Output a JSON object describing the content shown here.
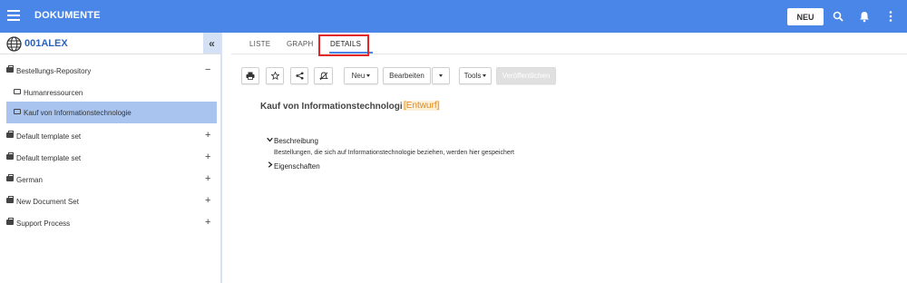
{
  "header": {
    "title": "DOKUMENTE",
    "new_button": "NEU",
    "bg_color": "#4a86e8"
  },
  "sidebar": {
    "workspace_title": "001ALEX",
    "collapse_label": "«",
    "items": [
      {
        "label": "Bestellungs-Repository",
        "type": "repository",
        "sign": "−"
      },
      {
        "label": "Humanressourcen",
        "type": "folder"
      },
      {
        "label": "Kauf von Informationstechnologie",
        "type": "folder",
        "selected": true
      },
      {
        "label": "Default template set",
        "type": "repository",
        "sign": "+"
      },
      {
        "label": "Default template set",
        "type": "repository",
        "sign": "+"
      },
      {
        "label": "German",
        "type": "repository",
        "sign": "+"
      },
      {
        "label": "New Document Set",
        "type": "repository",
        "sign": "+"
      },
      {
        "label": "Support Process",
        "type": "repository",
        "sign": "+"
      }
    ]
  },
  "tabs": [
    {
      "label": "LISTE"
    },
    {
      "label": "GRAPH"
    },
    {
      "label": "DETAILS",
      "active": true
    }
  ],
  "toolbar": {
    "print_icon": "printer-icon",
    "favorite_icon": "star-icon",
    "share_icon": "share-icon",
    "notify_off_icon": "bell-off-icon",
    "new_label": "Neu",
    "edit_label": "Bearbeiten",
    "tools_label": "Tools",
    "publish_label": "Veröffentlichen"
  },
  "document": {
    "title": "Kauf von Informationstechnologie",
    "status": "[Entwurf]",
    "description_heading": "Beschreibung",
    "description_text": "Bestellungen, die sich auf Informationstechnologie beziehen, werden hier gespeichert",
    "properties_heading": "Eigenschaften"
  },
  "colors": {
    "accent": "#4a86e8",
    "selected_row": "#a9c5ef",
    "draft": "#e08a1e",
    "highlight_box": "#e32626"
  }
}
